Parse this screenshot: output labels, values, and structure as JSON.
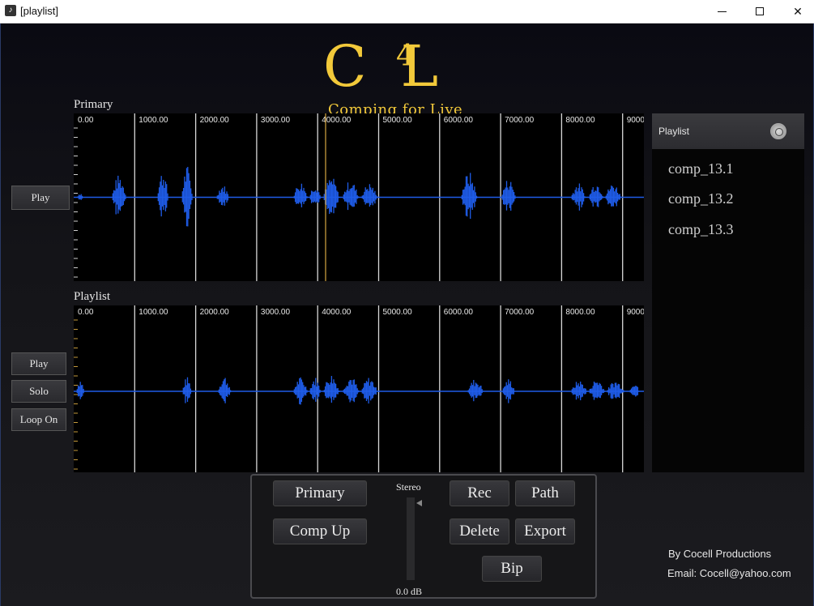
{
  "window": {
    "title": "[playlist]",
    "app_icon": "music-note-icon"
  },
  "logo": {
    "main": "C",
    "superscript": "4",
    "tail": "L",
    "tagline": "Comping for Live",
    "color": "#f2c93a"
  },
  "primary": {
    "label": "Primary",
    "ticks": [
      "0.00",
      "1000.00",
      "2000.00",
      "3000.00",
      "4000.00",
      "5000.00",
      "6000.00",
      "7000.00",
      "8000.00",
      "9000"
    ],
    "play_label": "Play"
  },
  "playlist_track": {
    "label": "Playlist",
    "ticks": [
      "0.00",
      "1000.00",
      "2000.00",
      "3000.00",
      "4000.00",
      "5000.00",
      "6000.00",
      "7000.00",
      "8000.00",
      "9000"
    ],
    "play_label": "Play",
    "solo_label": "Solo",
    "loop_label": "Loop On"
  },
  "playlist_panel": {
    "title": "Playlist",
    "items": [
      "comp_13.1",
      "comp_13.2",
      "comp_13.3"
    ]
  },
  "controls": {
    "primary": "Primary",
    "comp_up": "Comp Up",
    "meter_top": "Stereo",
    "meter_bottom": "0.0 dB",
    "rec": "Rec",
    "path": "Path",
    "delete": "Delete",
    "export": "Export",
    "bip": "Bip"
  },
  "credits": {
    "by": "By Cocell Productions",
    "email": "Email: Cocell@yahoo.com"
  },
  "colors": {
    "waveform": "#1f5ce8",
    "playhead": "#c59a3c",
    "tick_accent": "#c59a3c"
  }
}
